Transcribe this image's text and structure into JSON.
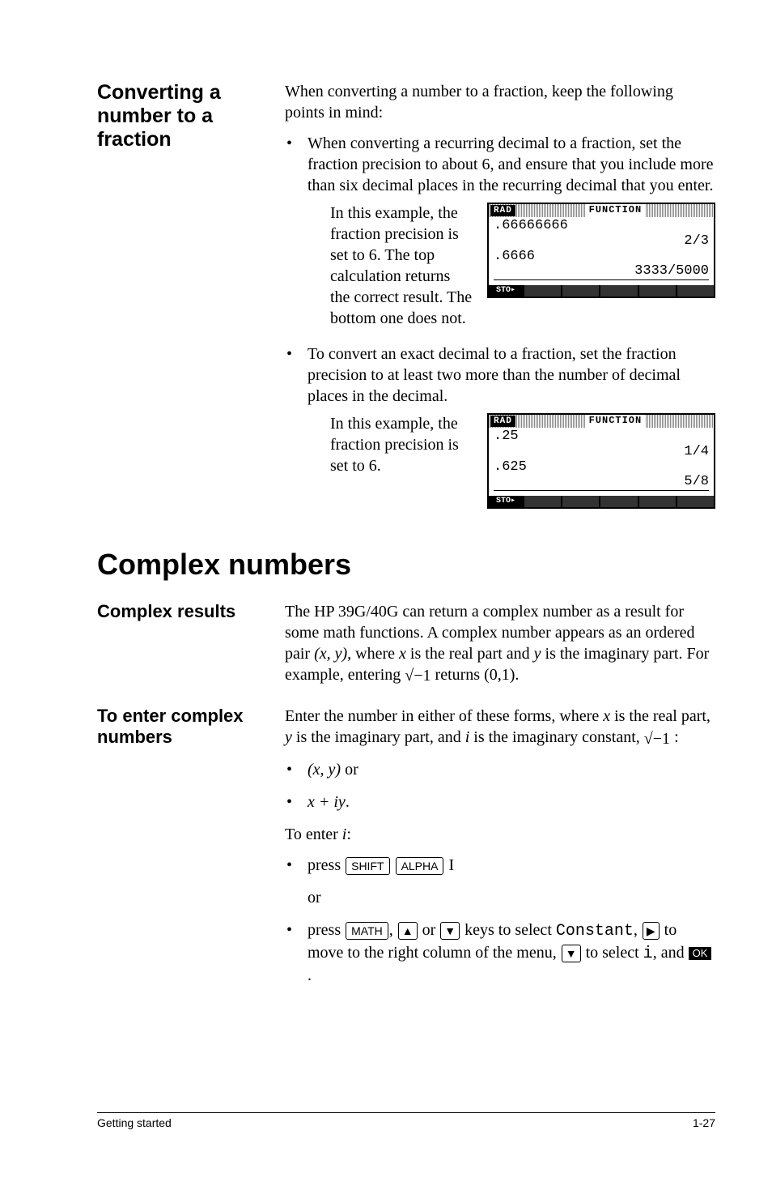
{
  "section1": {
    "heading": "Converting a number to a fraction",
    "intro": "When converting a number to a fraction, keep the following points in mind:",
    "bullet1": "When converting a recurring decimal to a fraction, set the fraction precision to about 6, and ensure that you include more than six decimal places in the recurring decimal that you enter.",
    "sub1": "In this example, the fraction precision is set to 6. The top calculation returns the correct result. The bottom one does not.",
    "bullet2": "To convert an exact decimal to a fraction, set the fraction precision to at least two more than the number of decimal places in the decimal.",
    "sub2": "In this example, the fraction precision is set to 6."
  },
  "calc1": {
    "rad": "RAD",
    "func": "FUNCTION",
    "l1a": ".66666666",
    "l1b": "2/3",
    "l2a": ".6666",
    "l2b": "3333/5000",
    "sto": "STO▸"
  },
  "calc2": {
    "rad": "RAD",
    "func": "FUNCTION",
    "l1a": ".25",
    "l1b": "1/4",
    "l2a": ".625",
    "l2b": "5/8",
    "sto": "STO▸"
  },
  "main_heading": "Complex numbers",
  "section2": {
    "heading": "Complex results",
    "body_a": "The HP 39G/40G can return a complex number as a result for some math functions. A complex number appears as an ordered pair ",
    "body_b": ", where ",
    "body_c": " is the real part and ",
    "body_d": " is the imaginary part. For example, entering ",
    "body_e": " returns (0,1).",
    "pair": "(x, y)",
    "x": "x",
    "y": "y",
    "sqrt": "√−1"
  },
  "section3": {
    "heading": "To enter complex numbers",
    "body_a": "Enter the number in either of these forms, where ",
    "body_b": " is the real part, ",
    "body_c": " is the imaginary part, and ",
    "body_d": " is the imaginary constant, ",
    "body_e": " :",
    "x": "x",
    "y": "y",
    "i": "i",
    "sqrt": "√−1",
    "opt1": "(x, y)",
    "or1": " or",
    "opt2": "x + iy",
    "dot": ".",
    "toenter": "To enter ",
    "colon": ":",
    "press": "press ",
    "shift": "SHIFT",
    "alpha": "ALPHA",
    "Ikey": " I",
    "or_word": "or",
    "math": "MATH",
    "up": "▲",
    "down": "▼",
    "right": "▶",
    "keys_to": " keys to select ",
    "constant": "Constant",
    "comma_move": " to move to the right column of the menu, ",
    "to_select": " to select ",
    "i_mono": "i",
    "and": "and ",
    "ok": "OK",
    "period": ".",
    "comma": ", ",
    "or_inline": " or "
  },
  "footer": {
    "left": "Getting started",
    "right": "1-27"
  }
}
